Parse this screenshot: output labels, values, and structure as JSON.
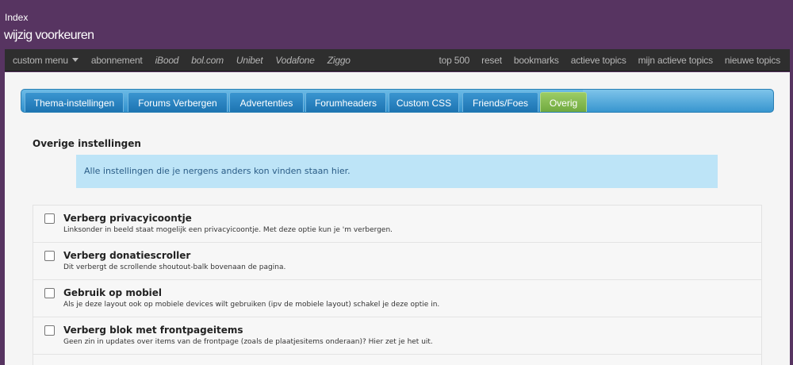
{
  "header": {
    "breadcrumb": "Index",
    "title": "wijzig voorkeuren"
  },
  "nav": {
    "left": [
      {
        "label": "custom menu",
        "has_dropdown": true
      },
      {
        "label": "abonnement"
      },
      {
        "label": "iBood",
        "italic": true
      },
      {
        "label": "bol.com",
        "italic": true
      },
      {
        "label": "Unibet",
        "italic": true
      },
      {
        "label": "Vodafone",
        "italic": true
      },
      {
        "label": "Ziggo",
        "italic": true
      }
    ],
    "right": [
      {
        "label": "top 500"
      },
      {
        "label": "reset"
      },
      {
        "label": "bookmarks"
      },
      {
        "label": "actieve topics"
      },
      {
        "label": "mijn actieve topics"
      },
      {
        "label": "nieuwe topics"
      }
    ]
  },
  "tabs": [
    {
      "label": "Thema-instellingen"
    },
    {
      "label": "Forums Verbergen"
    },
    {
      "label": "Advertenties"
    },
    {
      "label": "Forumheaders"
    },
    {
      "label": "Custom CSS"
    },
    {
      "label": "Friends/Foes"
    },
    {
      "label": "Overig",
      "active": true
    }
  ],
  "main": {
    "section_title": "Overige instellingen",
    "info": "Alle instellingen die je nergens anders kon vinden staan hier.",
    "options": [
      {
        "title": "Verberg privacyicoontje",
        "desc": "Linksonder in beeld staat mogelijk een privacyicoontje. Met deze optie kun je 'm verbergen.",
        "checked": false
      },
      {
        "title": "Verberg donatiescroller",
        "desc": "Dit verbergt de scrollende shoutout-balk bovenaan de pagina.",
        "checked": false
      },
      {
        "title": "Gebruik op mobiel",
        "desc": "Als je deze layout ook op mobiele devices wilt gebruiken (ipv de mobiele layout) schakel je deze optie in.",
        "checked": false
      },
      {
        "title": "Verberg blok met frontpageitems",
        "desc": "Geen zin in updates over items van de frontpage (zoals de plaatjesitems onderaan)? Hier zet je het uit.",
        "checked": false
      }
    ]
  },
  "colors": {
    "header_bg": "#573461",
    "navbar_bg": "#2e2e2e",
    "tab_blue": "#2e8fcc",
    "tab_active_green": "#7cb342",
    "info_bg": "#bde4f7"
  }
}
